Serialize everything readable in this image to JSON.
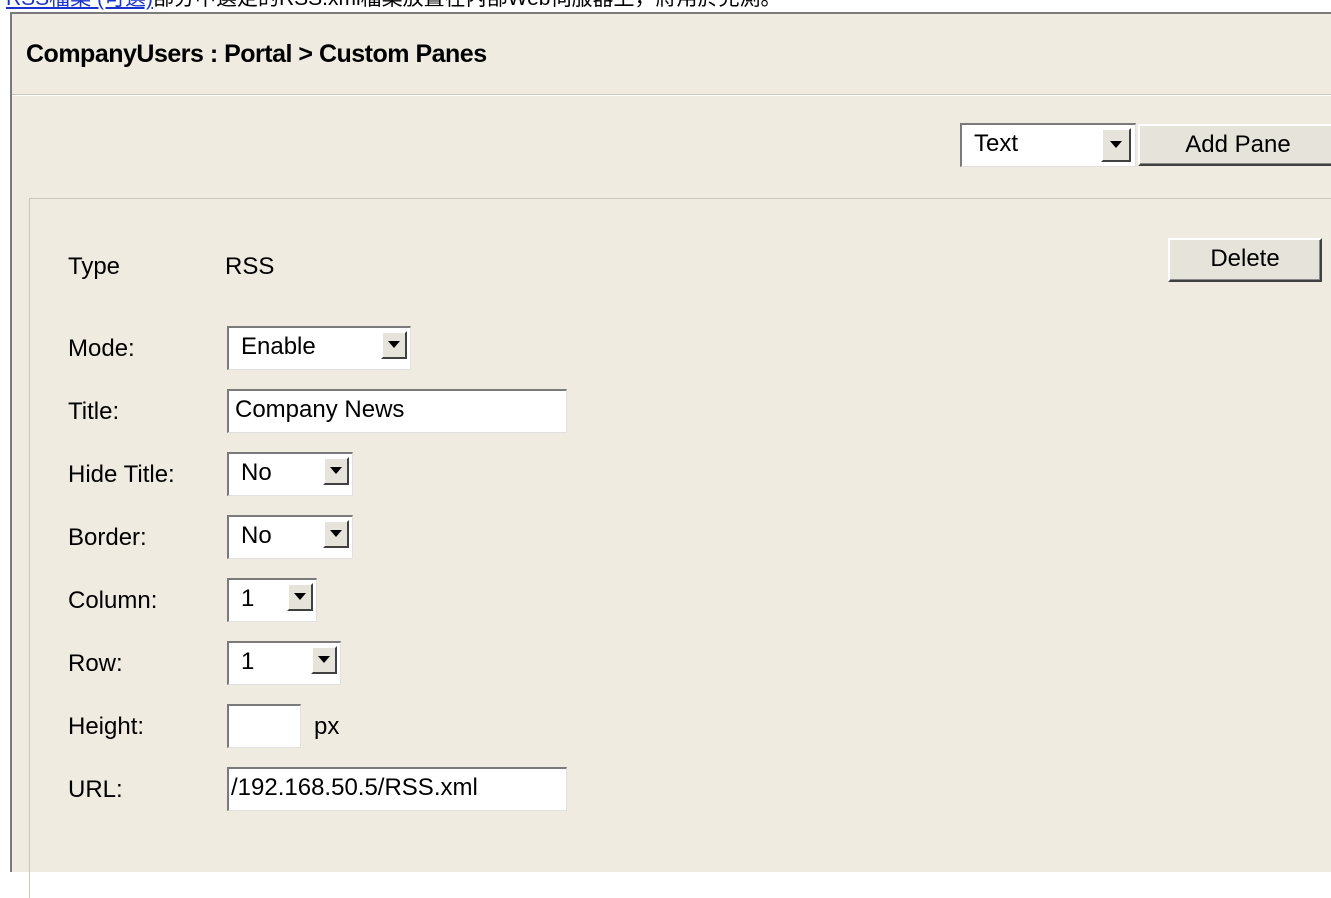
{
  "banner": {
    "link_text": "RSS檔案 (可選)",
    "rest_text": "部分中選定的RSS.xml檔案放置在內部Web伺服器上，將用於見測。"
  },
  "header": {
    "title": "CompanyUsers : Portal > Custom Panes"
  },
  "toolbar": {
    "pane_type_selected": "Text",
    "add_pane_label": "Add Pane"
  },
  "pane": {
    "type_label": "Type",
    "type_value": "RSS",
    "delete_label": "Delete",
    "fields": {
      "mode": {
        "label": "Mode:",
        "value": "Enable"
      },
      "title": {
        "label": "Title:",
        "value": "Company News"
      },
      "hide_title": {
        "label": "Hide Title:",
        "value": "No"
      },
      "border": {
        "label": "Border:",
        "value": "No"
      },
      "column": {
        "label": "Column:",
        "value": "1"
      },
      "row": {
        "label": "Row:",
        "value": "1"
      },
      "height": {
        "label": "Height:",
        "value": "",
        "unit": "px"
      },
      "url": {
        "label": "URL:",
        "value": "/192.168.50.5/RSS.xml"
      }
    }
  },
  "icons": {
    "dropdown": "chevron-down-icon"
  }
}
